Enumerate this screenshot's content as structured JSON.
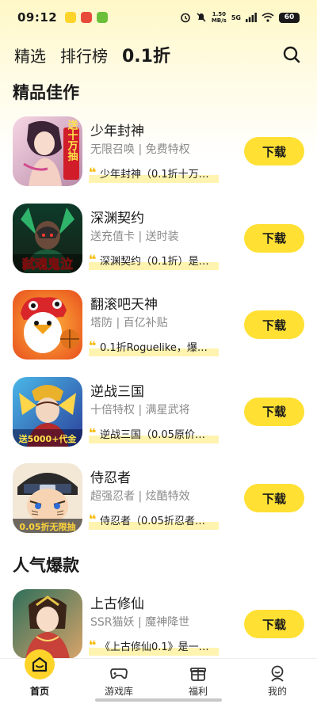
{
  "status_bar": {
    "time": "09:12",
    "net_speed_value": "1.50",
    "net_speed_unit": "MB/s",
    "signal": "5G",
    "battery": "60"
  },
  "tabs": [
    {
      "label": "精选",
      "active": false
    },
    {
      "label": "排行榜",
      "active": false
    },
    {
      "label": "0.1折",
      "active": true
    }
  ],
  "sections": {
    "featured_title": "精品佳作",
    "popular_title": "人气爆款"
  },
  "featured_games": [
    {
      "name": "少年封神",
      "tags": "无限召唤 | 免费特权",
      "quote": "少年封神（0.1折十万…",
      "button": "下载",
      "icon": "game-icon-shaonian-fengshen",
      "icon_text": "送十万抽"
    },
    {
      "name": "深渊契约",
      "tags": "送充值卡 | 送时装",
      "quote": "深渊契约（0.1折）是…",
      "button": "下载",
      "icon": "game-icon-shenyuan-qiyue",
      "icon_text": "弑魂鬼泣"
    },
    {
      "name": "翻滚吧天神",
      "tags": "塔防 | 百亿补贴",
      "quote": "0.1折Roguelike，爆…",
      "button": "下载",
      "icon": "game-icon-fangun-tianshen",
      "icon_text": ""
    },
    {
      "name": "逆战三国",
      "tags": "十倍特权 | 满星武将",
      "quote": "逆战三国（0.05原价…",
      "button": "下载",
      "icon": "game-icon-nizhan-sanguo",
      "icon_text": "送5000+代金"
    },
    {
      "name": "侍忍者",
      "tags": "超强忍者 | 炫酷特效",
      "quote": "侍忍者（0.05折忍者…",
      "button": "下载",
      "icon": "game-icon-shirenzhe",
      "icon_text": "0.05折无限抽"
    }
  ],
  "popular_games": [
    {
      "name": "上古修仙",
      "tags": "SSR猫妖 | 魔神降世",
      "quote": "《上古修仙0.1》是一…",
      "button": "下载",
      "icon": "game-icon-shanggu-xiuxian",
      "icon_text": ""
    }
  ],
  "bottom_nav": [
    {
      "label": "首页",
      "icon": "home-icon",
      "active": true
    },
    {
      "label": "游戏库",
      "icon": "gamepad-icon",
      "active": false
    },
    {
      "label": "福利",
      "icon": "gift-icon",
      "active": false
    },
    {
      "label": "我的",
      "icon": "profile-icon",
      "active": false
    }
  ],
  "colors": {
    "accent": "#ffd42a",
    "button": "#ffe033",
    "quote_mark": "#f5b800",
    "tag_text": "#8a8a8a"
  }
}
